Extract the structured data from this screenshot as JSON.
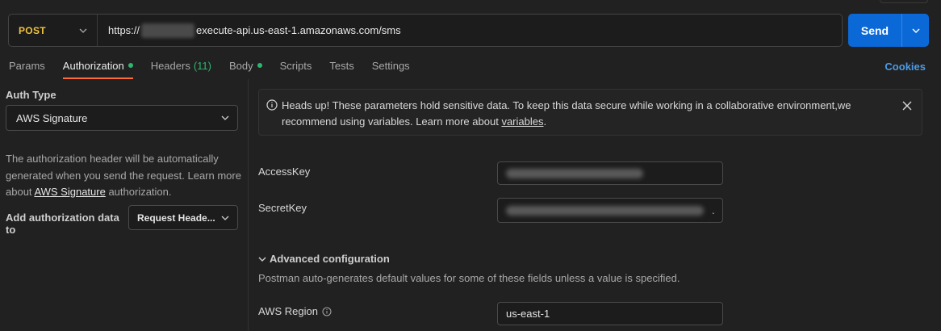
{
  "request": {
    "method": "POST",
    "url_prefix": "https://",
    "url_suffix": "execute-api.us-east-1.amazonaws.com/sms",
    "send_label": "Send"
  },
  "tabs": [
    {
      "label": "Params"
    },
    {
      "label": "Authorization"
    },
    {
      "label": "Headers",
      "count": "(11)"
    },
    {
      "label": "Body"
    },
    {
      "label": "Scripts"
    },
    {
      "label": "Tests"
    },
    {
      "label": "Settings"
    }
  ],
  "cookies_label": "Cookies",
  "auth": {
    "type_label": "Auth Type",
    "type_value": "AWS Signature",
    "desc_part1": "The authorization header will be automatically generated when you send the request. Learn more about ",
    "desc_link": "AWS Signature",
    "desc_part2": " authorization.",
    "add_to_label": "Add authorization data to",
    "add_to_value": "Request Heade..."
  },
  "notice": {
    "text_part1": "Heads up! These parameters hold sensitive data. To keep this data secure while working in a collaborative environment,we recommend using variables. Learn more about ",
    "link": "variables",
    "text_part2": "."
  },
  "fields": {
    "access_key_label": "AccessKey",
    "secret_key_label": "SecretKey",
    "secret_key_trailing": "."
  },
  "advanced": {
    "title": "Advanced configuration",
    "description": "Postman auto-generates default values for some of these fields unless a value is specified.",
    "region_label": "AWS Region",
    "region_value": "us-east-1"
  },
  "colors": {
    "method": "#f0c341",
    "send": "#0b69d7",
    "active_tab_underline": "#ff6c37",
    "status_dot": "#2fb66e",
    "link": "#4c9be8"
  }
}
